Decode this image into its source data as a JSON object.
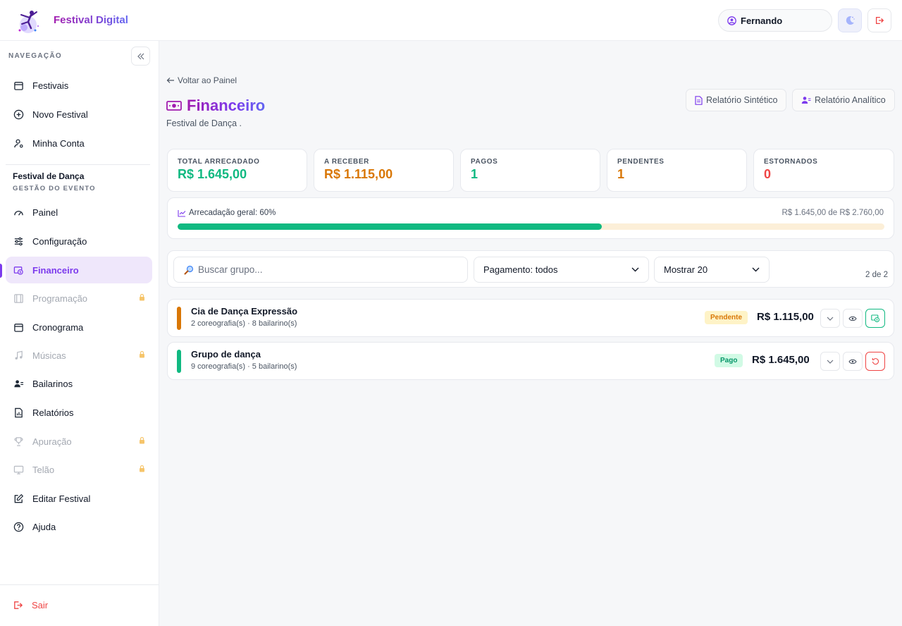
{
  "app": {
    "name": "Festival Digital"
  },
  "header": {
    "user_name": "Fernando"
  },
  "sidebar": {
    "nav_heading": "NAVEGAÇÃO",
    "top_items": [
      {
        "label": "Festivais"
      },
      {
        "label": "Novo Festival"
      },
      {
        "label": "Minha Conta"
      }
    ],
    "event_title": "Festival de Dança",
    "event_subtitle": "GESTÃO DO EVENTO",
    "event_items": [
      {
        "label": "Painel",
        "state": "normal"
      },
      {
        "label": "Configuração",
        "state": "normal"
      },
      {
        "label": "Financeiro",
        "state": "active"
      },
      {
        "label": "Programação",
        "state": "locked"
      },
      {
        "label": "Cronograma",
        "state": "normal"
      },
      {
        "label": "Músicas",
        "state": "locked"
      },
      {
        "label": "Bailarinos",
        "state": "normal"
      },
      {
        "label": "Relatórios",
        "state": "normal"
      },
      {
        "label": "Apuração",
        "state": "locked"
      },
      {
        "label": "Telão",
        "state": "locked"
      },
      {
        "label": "Editar Festival",
        "state": "normal"
      },
      {
        "label": "Ajuda",
        "state": "normal"
      }
    ],
    "logout_label": "Sair"
  },
  "main": {
    "back_label": "Voltar ao Painel",
    "title": "Financeiro",
    "subtitle": "Festival de Dança .",
    "report_synthetic": "Relatório Sintético",
    "report_analytic": "Relatório Analítico",
    "stats": [
      {
        "label": "TOTAL ARRECADADO",
        "value": "R$ 1.645,00",
        "color": "#10b981"
      },
      {
        "label": "A RECEBER",
        "value": "R$ 1.115,00",
        "color": "#d97706"
      },
      {
        "label": "PAGOS",
        "value": "1",
        "color": "#10b981"
      },
      {
        "label": "PENDENTES",
        "value": "1",
        "color": "#d97706"
      },
      {
        "label": "ESTORNADOS",
        "value": "0",
        "color": "#ef4444"
      }
    ],
    "progress": {
      "label": "Arrecadação geral: 60%",
      "summary": "R$ 1.645,00 de R$ 2.760,00",
      "fraction": 0.6
    },
    "filters": {
      "search_placeholder": "Buscar grupo...",
      "payment_select": "Pagamento: todos",
      "show_select": "Mostrar 20",
      "pager": "2 de 2"
    },
    "groups": [
      {
        "name": "Cia de Dança Expressão",
        "meta": "2 coreografia(s) · 8 bailarino(s)",
        "status": "Pendente",
        "amount": "R$ 1.115,00",
        "accent": "#d97706"
      },
      {
        "name": "Grupo de dança",
        "meta": "9 coreografia(s) · 5 bailarino(s)",
        "status": "Pago",
        "amount": "R$ 1.645,00",
        "accent": "#10b981"
      }
    ]
  }
}
